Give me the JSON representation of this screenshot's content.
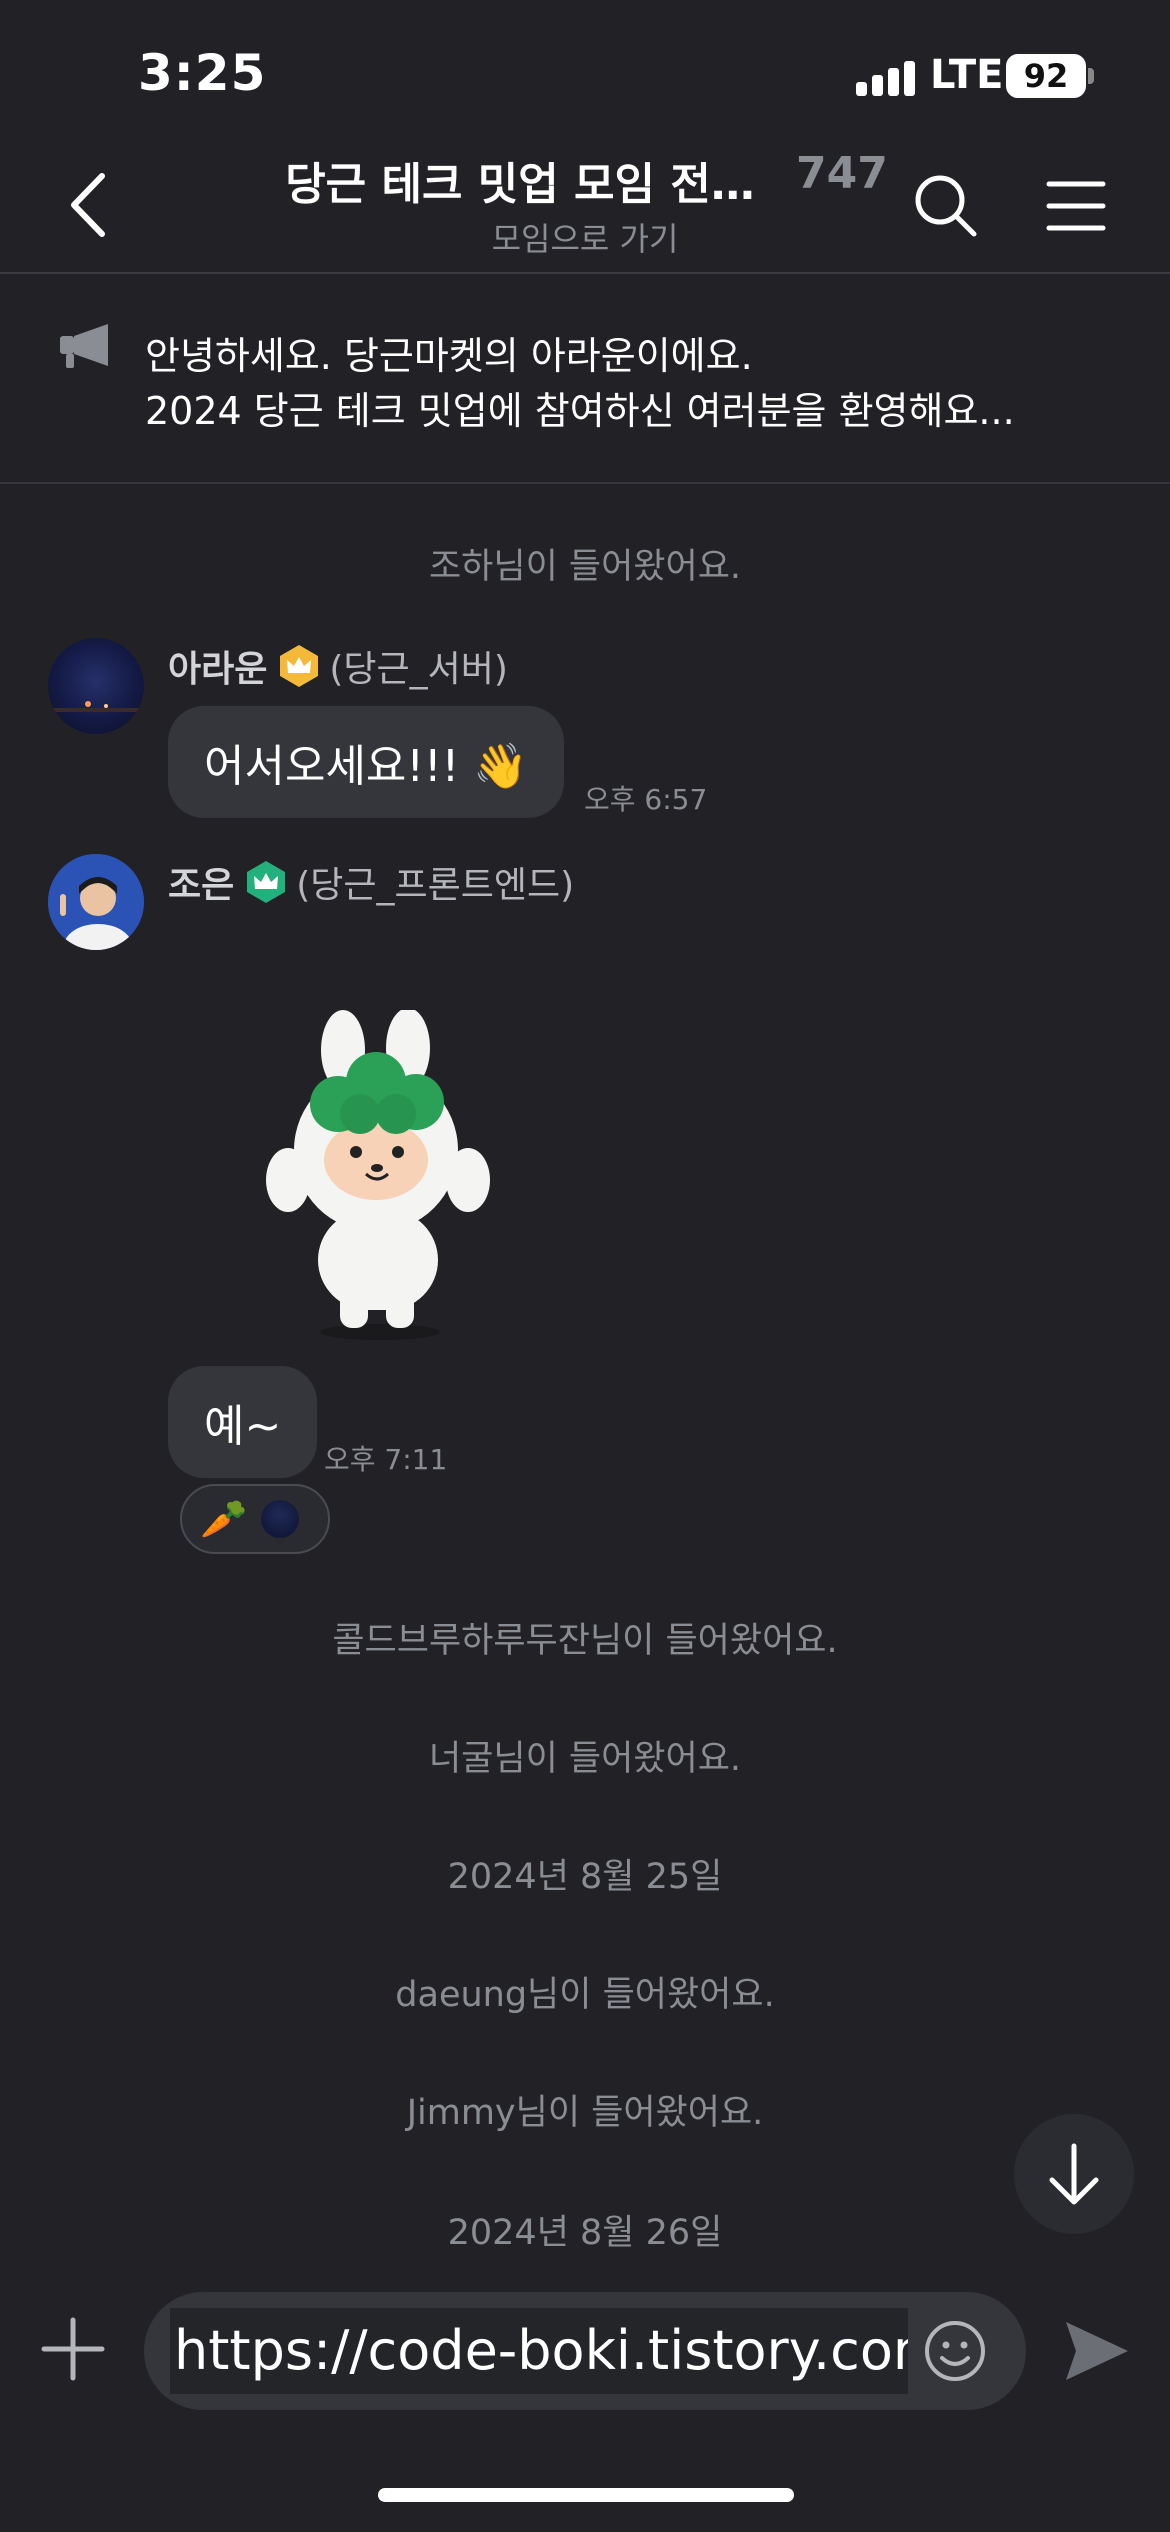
{
  "status_bar": {
    "time": "3:25",
    "network": "LTE",
    "battery": "92"
  },
  "header": {
    "title": "당근 테크 밋업 모임 전…",
    "member_count": "747",
    "subtitle": "모임으로 가기"
  },
  "notice": {
    "line1": "안녕하세요. 당근마켓의 아라운이에요.",
    "line2": "2024 당근 테크 밋업에 참여하신 여러분을 환영해요..."
  },
  "messages": {
    "sys_joined_1": "조하님이 들어왔어요.",
    "msg1": {
      "name": "아라운",
      "team": "(당근_서버)",
      "text": "어서오세요!!! 👋",
      "time": "오후 6:57"
    },
    "msg2": {
      "name": "조은",
      "team": "(당근_프론트엔드)",
      "text": "예~",
      "time": "오후 7:11",
      "reaction_emoji": "🥕"
    },
    "sys_joined_2": "콜드브루하루두잔님이 들어왔어요.",
    "sys_joined_3": "너굴님이 들어왔어요.",
    "date_1": "2024년 8월 25일",
    "sys_joined_4": "daeung님이 들어왔어요.",
    "sys_joined_5": "Jimmy님이 들어왔어요.",
    "date_2": "2024년 8월 26일"
  },
  "input": {
    "value": "https://code-boki.tistory.com"
  },
  "colors": {
    "background": "#222226",
    "bubble": "#35363c",
    "muted_text": "#8b8d94",
    "gold_badge": "#f5b93a",
    "green_badge": "#22b07d",
    "carrot_green": "#2aa157"
  }
}
